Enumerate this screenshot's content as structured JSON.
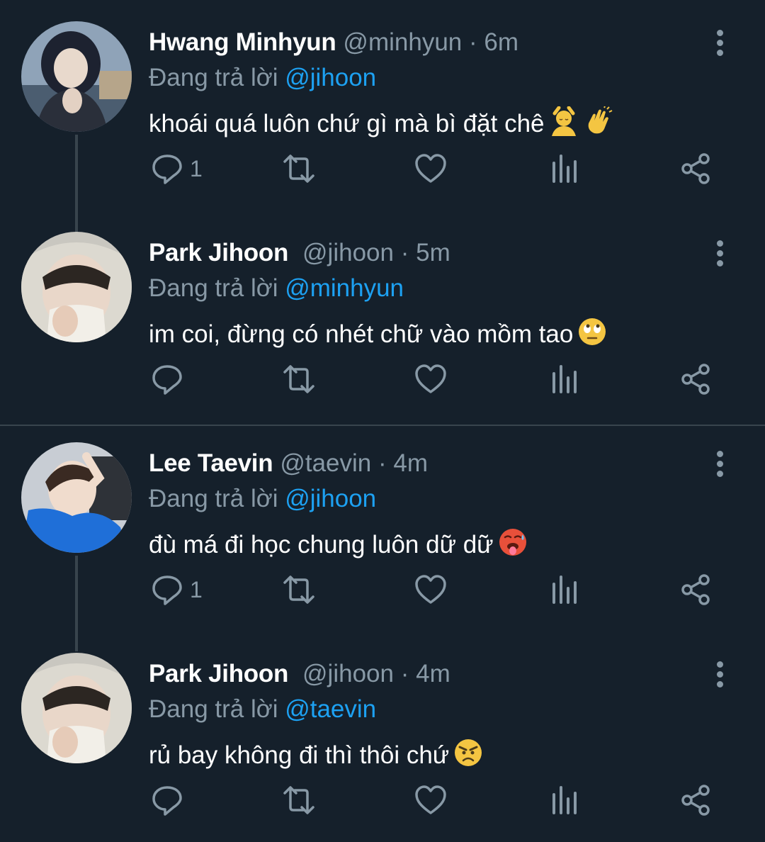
{
  "tweets": [
    {
      "name": "Hwang Minhyun",
      "handle": "@minhyun",
      "time": "· 6m",
      "reply_prefix": "Đang trả lời",
      "reply_to": "@jihoon",
      "text": "khoái quá luôn chứ gì mà bì đặt chê",
      "emojis": [
        "person-getting-massage-emoji",
        "waving-hand-emoji"
      ],
      "reply_count": "1"
    },
    {
      "name": "Park Jihoon",
      "handle": "@jihoon",
      "time": "· 5m",
      "reply_prefix": "Đang trả lời",
      "reply_to": "@minhyun",
      "text": "im coi, đừng có nhét chữ vào mồm tao",
      "emojis": [
        "eye-roll-emoji"
      ],
      "reply_count": ""
    },
    {
      "name": "Lee Taevin",
      "handle": "@taevin",
      "time": "· 4m",
      "reply_prefix": "Đang trả lời",
      "reply_to": "@jihoon",
      "text": "đù má đi học chung luôn dữ dữ",
      "emojis": [
        "hot-face-emoji"
      ],
      "reply_count": "1"
    },
    {
      "name": "Park Jihoon",
      "handle": "@jihoon",
      "time": "· 4m",
      "reply_prefix": "Đang trả lời",
      "reply_to": "@taevin",
      "text": "rủ bay không đi thì thôi chứ",
      "emojis": [
        "angry-face-emoji"
      ],
      "reply_count": ""
    }
  ],
  "colors": {
    "background": "#15202b",
    "secondary_text": "#8899a6",
    "mention": "#1da1f2",
    "divider": "#38444d"
  }
}
